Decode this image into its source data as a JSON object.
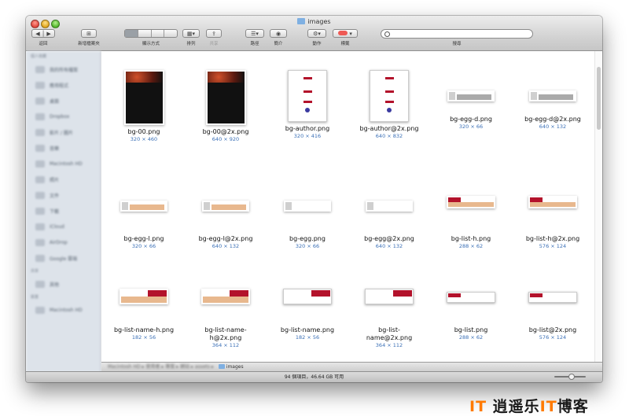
{
  "window": {
    "title": "images"
  },
  "toolbar": {
    "back_label": "返回",
    "newfolder_label": "新增檔案夾",
    "view_label": "顯示方式",
    "arrange_label": "排列",
    "share_label": "共享",
    "path_label": "路徑",
    "info_label": "簡介",
    "action_label": "動作",
    "tag_label": "標籤",
    "search_label": "搜尋"
  },
  "sidebar": {
    "headers": [
      "個人收藏",
      "共享",
      "裝置"
    ],
    "items": [
      "我的所有檔案",
      "應用程式",
      "桌面",
      "Dropbox",
      "影片 / 圖片",
      "音樂",
      "Macintosh HD",
      "照片",
      "文件",
      "下載",
      "iCloud",
      "AirDrop",
      "Google 雲端",
      "其他",
      "Macintosh HD"
    ]
  },
  "files": [
    {
      "name": "bg-00.png",
      "dims": "320 × 460"
    },
    {
      "name": "bg-00@2x.png",
      "dims": "640 × 920"
    },
    {
      "name": "bg-author.png",
      "dims": "320 × 416"
    },
    {
      "name": "bg-author@2x.png",
      "dims": "640 × 832"
    },
    {
      "name": "bg-egg-d.png",
      "dims": "320 × 66"
    },
    {
      "name": "bg-egg-d@2x.png",
      "dims": "640 × 132"
    },
    {
      "name": "bg-egg-l.png",
      "dims": "320 × 66"
    },
    {
      "name": "bg-egg-l@2x.png",
      "dims": "640 × 132"
    },
    {
      "name": "bg-egg.png",
      "dims": "320 × 66"
    },
    {
      "name": "bg-egg@2x.png",
      "dims": "640 × 132"
    },
    {
      "name": "bg-list-h.png",
      "dims": "288 × 62"
    },
    {
      "name": "bg-list-h@2x.png",
      "dims": "576 × 124"
    },
    {
      "name": "bg-list-name-h.png",
      "dims": "182 × 56"
    },
    {
      "name": "bg-list-name-h@2x.png",
      "dims": "364 × 112"
    },
    {
      "name": "bg-list-name.png",
      "dims": "182 × 56"
    },
    {
      "name": "bg-list-name@2x.png",
      "dims": "364 × 112"
    },
    {
      "name": "bg-list.png",
      "dims": "288 × 62"
    },
    {
      "name": "bg-list@2x.png",
      "dims": "576 × 124"
    }
  ],
  "pathbar": {
    "blurred": "Macintosh HD ▸ 使用者 ▸ 專案 ▸ 網站 ▸ assets ▸",
    "current": "images"
  },
  "status": {
    "text": "94 個項目，46.64 GB 可用"
  },
  "watermark": {
    "prefix": "IT",
    "text": "逍遥乐",
    "it2": "IT",
    "suffix": "博客"
  },
  "colors": {
    "accent": "#3a6fb6",
    "dark_red": "#b3122b",
    "tan": "#e8b88e"
  }
}
